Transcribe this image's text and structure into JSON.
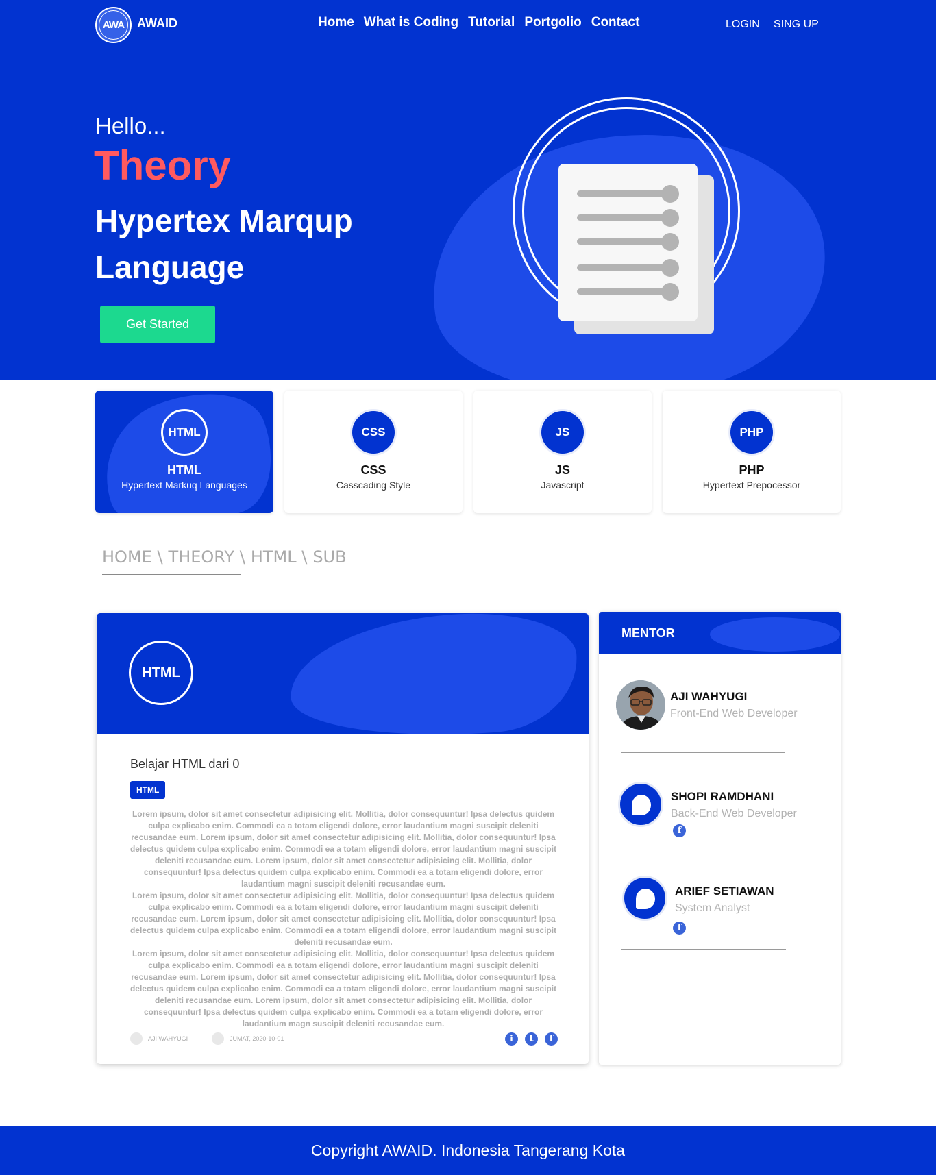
{
  "brand": {
    "logo_text": "AWA",
    "name": "AWAID"
  },
  "nav": {
    "links": [
      "Home",
      "What is Coding",
      "Tutorial",
      "Portgolio",
      "Contact"
    ],
    "login": "LOGIN",
    "signup": "SING UP"
  },
  "hero": {
    "greeting": "Hello...",
    "highlight": "Theory",
    "subtitle": "Hypertex Marqup Language",
    "cta": "Get Started"
  },
  "categories": [
    {
      "badge": "HTML",
      "title": "HTML",
      "desc": "Hypertext Markuq Languages",
      "active": true
    },
    {
      "badge": "CSS",
      "title": "CSS",
      "desc": "Casscading Style",
      "active": false
    },
    {
      "badge": "JS",
      "title": "JS",
      "desc": "Javascript",
      "active": false
    },
    {
      "badge": "PHP",
      "title": "PHP",
      "desc": "Hypertext Prepocessor",
      "active": false
    }
  ],
  "breadcrumb": [
    "HOME \\",
    "THEORY \\",
    "HTML \\",
    "SUB"
  ],
  "article": {
    "badge": "HTML",
    "title": "Belajar HTML dari 0",
    "tag": "HTML",
    "paragraphs": [
      "Lorem ipsum, dolor sit amet consectetur adipisicing elit. Mollitia, dolor consequuntur! Ipsa delectus quidem culpa explicabo enim. Commodi ea a totam eligendi dolore, error laudantium magni suscipit deleniti recusandae eum. Lorem ipsum, dolor sit amet consectetur adipisicing elit. Mollitia, dolor consequuntur! Ipsa delectus quidem culpa explicabo enim. Commodi ea a totam eligendi dolore, error laudantium magni suscipit deleniti recusandae eum. Lorem ipsum, dolor sit amet consectetur adipisicing elit. Mollitia, dolor consequuntur! Ipsa delectus quidem culpa explicabo enim. Commodi ea a totam eligendi dolore, error laudantium magni suscipit deleniti recusandae eum.",
      "Lorem ipsum, dolor sit amet consectetur adipisicing elit. Mollitia, dolor consequuntur! Ipsa delectus quidem culpa explicabo enim. Commodi ea a totam eligendi dolore, error laudantium magni suscipit deleniti recusandae eum. Lorem ipsum, dolor sit amet consectetur adipisicing elit. Mollitia, dolor consequuntur! Ipsa delectus quidem culpa explicabo enim. Commodi ea a totam eligendi dolore, error laudantium magni suscipit deleniti recusandae eum.",
      "Lorem ipsum, dolor sit amet consectetur adipisicing elit. Mollitia, dolor consequuntur! Ipsa delectus quidem culpa explicabo enim. Commodi ea a totam eligendi dolore, error laudantium magni suscipit deleniti recusandae eum. Lorem ipsum, dolor sit amet consectetur adipisicing elit. Mollitia, dolor consequuntur! Ipsa delectus quidem culpa explicabo enim. Commodi ea a totam eligendi dolore, error laudantium magni suscipit deleniti recusandae eum. Lorem ipsum, dolor sit amet consectetur adipisicing elit. Mollitia, dolor consequuntur! Ipsa delectus quidem culpa explicabo enim. Commodi ea a totam eligendi dolore, error laudantium magn suscipit deleniti recusandae eum."
    ],
    "author": "AJI WAHYUGI",
    "date": "JUMAT, 2020-10-01",
    "social_icons": [
      "info-icon",
      "twitter-icon",
      "facebook-icon"
    ],
    "social_glyphs": [
      "i",
      "t",
      "f"
    ]
  },
  "mentor": {
    "title": "MENTOR",
    "people": [
      {
        "name": "AJI WAHYUGI",
        "role": "Front-End Web Developer",
        "photo": true,
        "facebook": false
      },
      {
        "name": "SHOPI RAMDHANI",
        "role": "Back-End Web Developer",
        "photo": false,
        "facebook": true
      },
      {
        "name": "ARIEF SETIAWAN",
        "role": "System Analyst",
        "photo": false,
        "facebook": true
      }
    ],
    "facebook_glyph": "f"
  },
  "footer": {
    "text": "Copyright AWAID. Indonesia Tangerang Kota"
  },
  "colors": {
    "primary": "#0233d0",
    "blob": "#1d4be8",
    "accent": "#ff5a5f",
    "cta": "#1cd98f"
  }
}
